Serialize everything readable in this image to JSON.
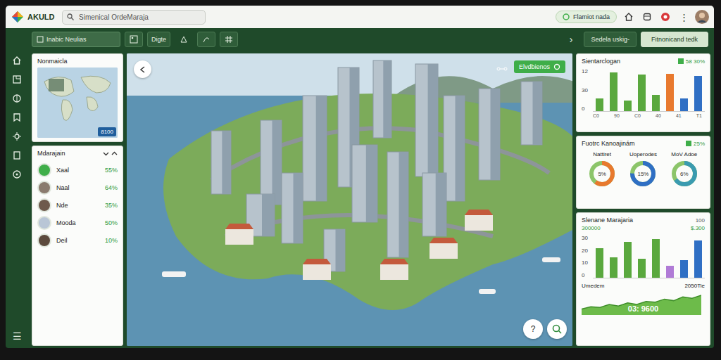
{
  "app": {
    "logo": "AKULD"
  },
  "search": {
    "placeholder": "Simenical OrdeMaraja"
  },
  "topbar": {
    "status": "Flamiot nada",
    "menu": "⋮"
  },
  "toolbar": {
    "field": "Inabic Neulias",
    "button": "Digte",
    "chevron": "›",
    "tabs": [
      {
        "label": "Sedela uskig-",
        "selected": false
      },
      {
        "label": "Fitnonicand tedk",
        "selected": true
      }
    ]
  },
  "rail": {
    "menu": "☰"
  },
  "map_card": {
    "title": "Nonmaicla",
    "badge": "8100"
  },
  "list": {
    "title": "Mdarajain",
    "items": [
      {
        "name": "Xaal",
        "value": "55%",
        "color": "#3fae49"
      },
      {
        "name": "Naal",
        "value": "64%",
        "color": "#8a7b6e"
      },
      {
        "name": "Nde",
        "value": "35%",
        "color": "#6e5a4c"
      },
      {
        "name": "Mooda",
        "value": "50%",
        "color": "#b9c6d6"
      },
      {
        "name": "Deil",
        "value": "10%",
        "color": "#5c4a3d"
      }
    ]
  },
  "map": {
    "button": "Elvdbienos",
    "help": "?"
  },
  "chart1": {
    "title": "Sientarclogan",
    "value": "58 30%",
    "ticks": [
      "12",
      "30",
      "0"
    ],
    "x_labels": [
      "C0",
      "90",
      "C0",
      "40",
      "41",
      "T1"
    ],
    "bars": [
      {
        "value": 12,
        "color": "#5aa83e"
      },
      {
        "value": 36,
        "color": "#5aa83e"
      },
      {
        "value": 10,
        "color": "#5aa83e"
      },
      {
        "value": 34,
        "color": "#5aa83e"
      },
      {
        "value": 15,
        "color": "#5aa83e"
      },
      {
        "value": 35,
        "color": "#e8792e"
      },
      {
        "value": 12,
        "color": "#2f6fc4"
      },
      {
        "value": 33,
        "color": "#2f6fc4"
      }
    ]
  },
  "donut_card": {
    "title": "Fuotrc Kanoajinám",
    "value": "25%",
    "donuts": [
      {
        "label": "Nattiret",
        "reading": "5%",
        "level": 0.6,
        "color": "#e8792e"
      },
      {
        "label": "Uoperodes",
        "reading": "15%",
        "level": 0.75,
        "color": "#2f6fc4"
      },
      {
        "label": "MoV Adoe",
        "reading": "6%",
        "level": 0.65,
        "color": "#3a9bb0"
      }
    ]
  },
  "chart2": {
    "title": "Slenane Marajaria",
    "count": "100",
    "value": "300000",
    "amount": "$.300",
    "ticks": [
      "30",
      "20",
      "10",
      "0"
    ],
    "bars": [
      {
        "value": 22,
        "color": "#5aa83e"
      },
      {
        "value": 15,
        "color": "#5aa83e"
      },
      {
        "value": 27,
        "color": "#5aa83e"
      },
      {
        "value": 14,
        "color": "#5aa83e"
      },
      {
        "value": 29,
        "color": "#5aa83e"
      },
      {
        "value": 9,
        "color": "#b07bd6"
      },
      {
        "value": 13,
        "color": "#2f6fc4"
      },
      {
        "value": 28,
        "color": "#2f6fc4"
      }
    ],
    "area": {
      "label": "Umedem",
      "period": "2050Tie",
      "total": "03: 9600",
      "values": [
        6,
        9,
        8,
        12,
        10,
        14,
        12,
        16,
        15,
        19,
        17,
        22,
        20,
        24
      ]
    }
  }
}
